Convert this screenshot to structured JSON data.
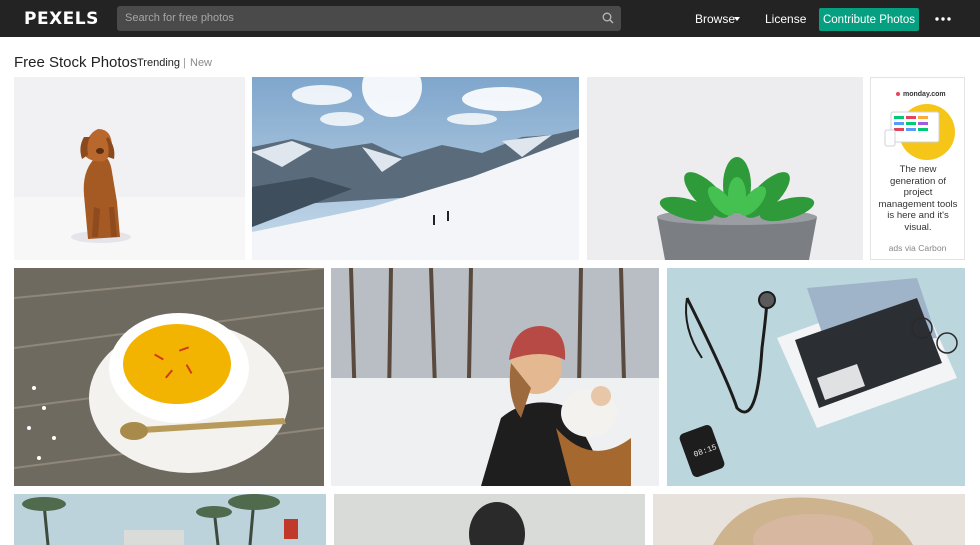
{
  "header": {
    "logo": "PEXELS",
    "search_placeholder": "Search for free photos",
    "browse_label": "Browse",
    "license_label": "License",
    "contribute_label": "Contribute Photos",
    "accent_color": "#05a081"
  },
  "main": {
    "title": "Free Stock Photos",
    "tabs": [
      {
        "label": "Trending",
        "active": true
      },
      {
        "label": "New",
        "active": false
      }
    ],
    "separator": "|"
  },
  "ad": {
    "brand": "monday.com",
    "text": "The new generation of project management tools is here and it's visual.",
    "via": "ads via Carbon"
  },
  "photos": [
    {
      "subject": "golden retriever sitting in snow"
    },
    {
      "subject": "two skiers on a snowy mountain slope"
    },
    {
      "subject": "green succulent in grey pot"
    },
    {
      "subject": "cup of saffron tea with spoon on wooden table"
    },
    {
      "subject": "mother carrying baby in snowy forest"
    },
    {
      "subject": "stethoscope, laptop and phone on blue desk"
    },
    {
      "subject": "palm trees on a beach"
    },
    {
      "subject": "person seen from behind"
    },
    {
      "subject": "woman with blonde hair"
    }
  ]
}
